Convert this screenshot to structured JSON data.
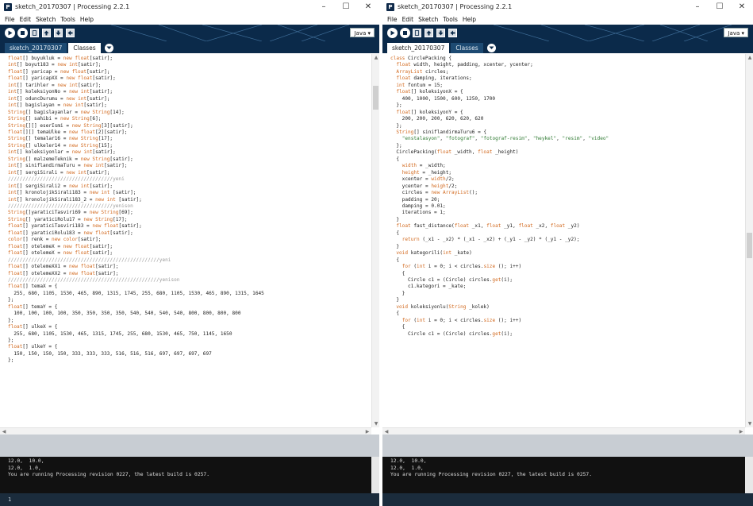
{
  "left": {
    "title": "sketch_20170307 | Processing 2.2.1",
    "menu": [
      "File",
      "Edit",
      "Sketch",
      "Tools",
      "Help"
    ],
    "mode": "Java ▾",
    "tabs": [
      "sketch_20170307",
      "Classes"
    ],
    "code": [
      [
        [
          "kw",
          "float"
        ],
        [
          "t",
          "[] buyukluk = "
        ],
        [
          "kw",
          "new float"
        ],
        [
          "t",
          "[satir];"
        ]
      ],
      [
        [
          "kw",
          "int"
        ],
        [
          "t",
          "[] boyut183 = "
        ],
        [
          "kw",
          "new int"
        ],
        [
          "t",
          "[satir];"
        ]
      ],
      [
        [
          "kw",
          "float"
        ],
        [
          "t",
          "[] yaricap = "
        ],
        [
          "kw",
          "new float"
        ],
        [
          "t",
          "[satir];"
        ]
      ],
      [
        [
          "kw",
          "float"
        ],
        [
          "t",
          "[] yaricapXX = "
        ],
        [
          "kw",
          "new float"
        ],
        [
          "t",
          "[satir];"
        ]
      ],
      [
        [
          "kw",
          "int"
        ],
        [
          "t",
          "[] tarihler = "
        ],
        [
          "kw",
          "new int"
        ],
        [
          "t",
          "[satir];"
        ]
      ],
      [
        [
          "kw",
          "int"
        ],
        [
          "t",
          "[] koleksiyonNo = "
        ],
        [
          "kw",
          "new int"
        ],
        [
          "t",
          "[satir];"
        ]
      ],
      [
        [
          "kw",
          "int"
        ],
        [
          "t",
          "[] oduncDurumu = "
        ],
        [
          "kw",
          "new int"
        ],
        [
          "t",
          "[satir];"
        ]
      ],
      [
        [
          "kw",
          "int"
        ],
        [
          "t",
          "[] bagislayan = "
        ],
        [
          "kw",
          "new int"
        ],
        [
          "t",
          "[satir];"
        ]
      ],
      [
        [
          "kw",
          "String"
        ],
        [
          "t",
          "[] bagislayanlar = "
        ],
        [
          "kw",
          "new String"
        ],
        [
          "t",
          "[14];"
        ]
      ],
      [
        [
          "kw",
          "String"
        ],
        [
          "t",
          "[] sahibi = "
        ],
        [
          "kw",
          "new String"
        ],
        [
          "t",
          "[6];"
        ]
      ],
      [
        [
          "kw",
          "String"
        ],
        [
          "t",
          "[][] eserIsmi = "
        ],
        [
          "kw",
          "new String"
        ],
        [
          "t",
          "[3][satir];"
        ]
      ],
      [
        [
          "kw",
          "float"
        ],
        [
          "t",
          "[][] temaUlke = "
        ],
        [
          "kw",
          "new float"
        ],
        [
          "t",
          "[2][satir];"
        ]
      ],
      [
        [
          "kw",
          "String"
        ],
        [
          "t",
          "[] temalar16 = "
        ],
        [
          "kw",
          "new String"
        ],
        [
          "t",
          "[17];"
        ]
      ],
      [
        [
          "kw",
          "String"
        ],
        [
          "t",
          "[] ulkeler14 = "
        ],
        [
          "kw",
          "new String"
        ],
        [
          "t",
          "[15];"
        ]
      ],
      [
        [
          "kw",
          "int"
        ],
        [
          "t",
          "[] koleksiyonlar = "
        ],
        [
          "kw",
          "new int"
        ],
        [
          "t",
          "[satir];"
        ]
      ],
      [
        [
          "kw",
          "String"
        ],
        [
          "t",
          "[] malzemeTeknik = "
        ],
        [
          "kw",
          "new String"
        ],
        [
          "t",
          "[satir];"
        ]
      ],
      [
        [
          "kw",
          "int"
        ],
        [
          "t",
          "[] siniflandirmaTuru = "
        ],
        [
          "kw",
          "new int"
        ],
        [
          "t",
          "[satir];"
        ]
      ],
      [
        [
          "kw",
          "int"
        ],
        [
          "t",
          "[] sergiSirali = "
        ],
        [
          "kw",
          "new int"
        ],
        [
          "t",
          "[satir];"
        ]
      ],
      [
        [
          "t",
          ""
        ]
      ],
      [
        [
          "cmt",
          "////////////////////////////////////yeni"
        ]
      ],
      [
        [
          "kw",
          "int"
        ],
        [
          "t",
          "[] sergiSirali2 = "
        ],
        [
          "kw",
          "new int"
        ],
        [
          "t",
          "[satir];"
        ]
      ],
      [
        [
          "kw",
          "int"
        ],
        [
          "t",
          "[] kronolojikSirali183 = "
        ],
        [
          "kw",
          "new int"
        ],
        [
          "t",
          " [satir];"
        ]
      ],
      [
        [
          "kw",
          "int"
        ],
        [
          "t",
          "[] kronolojikSirali183_2 = "
        ],
        [
          "kw",
          "new int"
        ],
        [
          "t",
          " [satir];"
        ]
      ],
      [
        [
          "cmt",
          "////////////////////////////////////yenison"
        ]
      ],
      [
        [
          "t",
          ""
        ]
      ],
      [
        [
          "kw",
          "String"
        ],
        [
          "t",
          "[]yaraticiTasviri69 = "
        ],
        [
          "kw",
          "new String"
        ],
        [
          "t",
          "[69];"
        ]
      ],
      [
        [
          "kw",
          "String"
        ],
        [
          "t",
          "[] yaraticiRolu17 = "
        ],
        [
          "kw",
          "new String"
        ],
        [
          "t",
          "[17];"
        ]
      ],
      [
        [
          "kw",
          "float"
        ],
        [
          "t",
          "[] yaraticiTasviri183 = "
        ],
        [
          "kw",
          "new float"
        ],
        [
          "t",
          "[satir];"
        ]
      ],
      [
        [
          "kw",
          "float"
        ],
        [
          "t",
          "[] yaraticiRolu183 = "
        ],
        [
          "kw",
          "new float"
        ],
        [
          "t",
          "[satir];"
        ]
      ],
      [
        [
          "kw",
          "color"
        ],
        [
          "t",
          "[] renk = "
        ],
        [
          "kw",
          "new color"
        ],
        [
          "t",
          "[satir];"
        ]
      ],
      [
        [
          "kw",
          "float"
        ],
        [
          "t",
          "[] otelemeX = "
        ],
        [
          "kw",
          "new float"
        ],
        [
          "t",
          "[satir];"
        ]
      ],
      [
        [
          "kw",
          "float"
        ],
        [
          "t",
          "[] otelemeX = "
        ],
        [
          "kw",
          "new float"
        ],
        [
          "t",
          "[satir];"
        ]
      ],
      [
        [
          "cmt",
          "////////////////////////////////////////////////////yeni"
        ]
      ],
      [
        [
          "kw",
          "float"
        ],
        [
          "t",
          "[] otelemeXX1 = "
        ],
        [
          "kw",
          "new float"
        ],
        [
          "t",
          "[satir];"
        ]
      ],
      [
        [
          "kw",
          "float"
        ],
        [
          "t",
          "[] otelemeXX2 = "
        ],
        [
          "kw",
          "new float"
        ],
        [
          "t",
          "[satir];"
        ]
      ],
      [
        [
          "cmt",
          "////////////////////////////////////////////////////yenison"
        ]
      ],
      [
        [
          "kw",
          "float"
        ],
        [
          "t",
          "[] temaX = {"
        ]
      ],
      [
        [
          "t",
          "  255, 680, 1105, 1530, 465, 890, 1315, 1745, 255, 680, 1105, 1530, 465, 890, 1315, 1645"
        ]
      ],
      [
        [
          "t",
          "};"
        ]
      ],
      [
        [
          "kw",
          "float"
        ],
        [
          "t",
          "[] temaY = {"
        ]
      ],
      [
        [
          "t",
          "  100, 100, 100, 100, 350, 350, 350, 350, 540, 540, 540, 540, 800, 800, 800, 800"
        ]
      ],
      [
        [
          "t",
          "};"
        ]
      ],
      [
        [
          "kw",
          "float"
        ],
        [
          "t",
          "[] ulkeX = {"
        ]
      ],
      [
        [
          "t",
          "  255, 680, 1105, 1530, 465, 1315, 1745, 255, 680, 1530, 465, 750, 1145, 1650"
        ]
      ],
      [
        [
          "t",
          "};"
        ]
      ],
      [
        [
          "kw",
          "float"
        ],
        [
          "t",
          "[] ulkeY = {"
        ]
      ],
      [
        [
          "t",
          "  150, 150, 150, 150, 333, 333, 333, 516, 516, 516, 697, 697, 697, 697"
        ]
      ],
      [
        [
          "t",
          "};"
        ]
      ]
    ],
    "console": [
      "12.0,  10.0,",
      "12.0,  1.0,",
      "You are running Processing revision 0227, the latest build is 0257."
    ],
    "status": "1"
  },
  "right": {
    "title": "sketch_20170307 | Processing 2.2.1",
    "menu": [
      "File",
      "Edit",
      "Sketch",
      "Tools",
      "Help"
    ],
    "mode": "Java ▾",
    "tabs": [
      "sketch_20170307",
      "Classes"
    ],
    "code": [
      [
        [
          "kw",
          "class"
        ],
        [
          "t",
          " CirclePacking {"
        ]
      ],
      [
        [
          "t",
          ""
        ]
      ],
      [
        [
          "t",
          "  "
        ],
        [
          "kw",
          "float"
        ],
        [
          "t",
          " width, height, padding, xcenter, ycenter;"
        ]
      ],
      [
        [
          "t",
          "  "
        ],
        [
          "kw",
          "ArrayList"
        ],
        [
          "t",
          " circles;"
        ]
      ],
      [
        [
          "t",
          "  "
        ],
        [
          "kw",
          "float"
        ],
        [
          "t",
          " damping, iterations;"
        ]
      ],
      [
        [
          "t",
          "  "
        ],
        [
          "kw",
          "int"
        ],
        [
          "t",
          " fontum = 15;"
        ]
      ],
      [
        [
          "t",
          "  "
        ],
        [
          "kw",
          "float"
        ],
        [
          "t",
          "[] koleksiyonX = {"
        ]
      ],
      [
        [
          "t",
          "    400, 1000, 1500, 600, 1250, 1700"
        ]
      ],
      [
        [
          "t",
          "  };"
        ]
      ],
      [
        [
          "t",
          "  "
        ],
        [
          "kw",
          "float"
        ],
        [
          "t",
          "[] koleksiyonY = {"
        ]
      ],
      [
        [
          "t",
          "    200, 200, 200, 620, 620, 620"
        ]
      ],
      [
        [
          "t",
          "  };"
        ]
      ],
      [
        [
          "t",
          "  "
        ],
        [
          "kw",
          "String"
        ],
        [
          "t",
          "[] siniflandirmaTuru6 = {"
        ]
      ],
      [
        [
          "t",
          "    "
        ],
        [
          "str",
          "\"enstalasyon\""
        ],
        [
          "t",
          ", "
        ],
        [
          "str",
          "\"fotograf\""
        ],
        [
          "t",
          ", "
        ],
        [
          "str",
          "\"fotograf-resim\""
        ],
        [
          "t",
          ", "
        ],
        [
          "str",
          "\"heykel\""
        ],
        [
          "t",
          ", "
        ],
        [
          "str",
          "\"resim\""
        ],
        [
          "t",
          ", "
        ],
        [
          "str",
          "\"video\""
        ]
      ],
      [
        [
          "t",
          "  };"
        ]
      ],
      [
        [
          "t",
          ""
        ]
      ],
      [
        [
          "t",
          ""
        ]
      ],
      [
        [
          "t",
          ""
        ]
      ],
      [
        [
          "t",
          "  CirclePacking("
        ],
        [
          "kw",
          "float"
        ],
        [
          "t",
          " _width, "
        ],
        [
          "kw",
          "float"
        ],
        [
          "t",
          " _height)"
        ]
      ],
      [
        [
          "t",
          "  {"
        ]
      ],
      [
        [
          "t",
          "    "
        ],
        [
          "kw",
          "width"
        ],
        [
          "t",
          " = _width;"
        ]
      ],
      [
        [
          "t",
          "    "
        ],
        [
          "kw",
          "height"
        ],
        [
          "t",
          " = _height;"
        ]
      ],
      [
        [
          "t",
          "    xcenter = "
        ],
        [
          "kw",
          "width"
        ],
        [
          "t",
          "/2;"
        ]
      ],
      [
        [
          "t",
          "    ycenter = "
        ],
        [
          "kw",
          "height"
        ],
        [
          "t",
          "/2;"
        ]
      ],
      [
        [
          "t",
          "    circles = "
        ],
        [
          "kw",
          "new ArrayList"
        ],
        [
          "t",
          "();"
        ]
      ],
      [
        [
          "t",
          "    padding = 20;"
        ]
      ],
      [
        [
          "t",
          "    damping = 0.01;"
        ]
      ],
      [
        [
          "t",
          "    iterations = 1;"
        ]
      ],
      [
        [
          "t",
          "  }"
        ]
      ],
      [
        [
          "t",
          ""
        ]
      ],
      [
        [
          "t",
          "  "
        ],
        [
          "kw",
          "float"
        ],
        [
          "t",
          " fast_distance("
        ],
        [
          "kw",
          "float"
        ],
        [
          "t",
          " _x1, "
        ],
        [
          "kw",
          "float"
        ],
        [
          "t",
          " _y1, "
        ],
        [
          "kw",
          "float"
        ],
        [
          "t",
          " _x2, "
        ],
        [
          "kw",
          "float"
        ],
        [
          "t",
          " _y2)"
        ]
      ],
      [
        [
          "t",
          "  {"
        ]
      ],
      [
        [
          "t",
          "    "
        ],
        [
          "kw",
          "return"
        ],
        [
          "t",
          " (_x1 - _x2) * (_x1 - _x2) + (_y1 - _y2) * (_y1 - _y2);"
        ]
      ],
      [
        [
          "t",
          "  }"
        ]
      ],
      [
        [
          "t",
          ""
        ]
      ],
      [
        [
          "t",
          "  "
        ],
        [
          "kw",
          "void"
        ],
        [
          "t",
          " kategorili("
        ],
        [
          "kw",
          "int"
        ],
        [
          "t",
          " _kate)"
        ]
      ],
      [
        [
          "t",
          "  {"
        ]
      ],
      [
        [
          "t",
          "    "
        ],
        [
          "kw",
          "for"
        ],
        [
          "t",
          " ("
        ],
        [
          "kw",
          "int"
        ],
        [
          "t",
          " i = 0; i < circles."
        ],
        [
          "kw",
          "size"
        ],
        [
          "t",
          " (); i++)"
        ]
      ],
      [
        [
          "t",
          "    {"
        ]
      ],
      [
        [
          "t",
          "      Circle c1 = (Circle) circles."
        ],
        [
          "kw",
          "get"
        ],
        [
          "t",
          "(i);"
        ]
      ],
      [
        [
          "t",
          "      c1.kategori = _kate;"
        ]
      ],
      [
        [
          "t",
          "    }"
        ]
      ],
      [
        [
          "t",
          "  }"
        ]
      ],
      [
        [
          "t",
          ""
        ]
      ],
      [
        [
          "t",
          "  "
        ],
        [
          "kw",
          "void"
        ],
        [
          "t",
          " koleksiyonlu("
        ],
        [
          "kw",
          "String"
        ],
        [
          "t",
          " _kolek)"
        ]
      ],
      [
        [
          "t",
          "  {"
        ]
      ],
      [
        [
          "t",
          "    "
        ],
        [
          "kw",
          "for"
        ],
        [
          "t",
          " ("
        ],
        [
          "kw",
          "int"
        ],
        [
          "t",
          " i = 0; i < circles."
        ],
        [
          "kw",
          "size"
        ],
        [
          "t",
          " (); i++)"
        ]
      ],
      [
        [
          "t",
          "    {"
        ]
      ],
      [
        [
          "t",
          "      Circle c1 = (Circle) circles."
        ],
        [
          "kw",
          "get"
        ],
        [
          "t",
          "(i);"
        ]
      ]
    ],
    "console": [
      "12.0,  10.0,",
      "12.0,  1.0,",
      "You are running Processing revision 0227, the latest build is 0257."
    ],
    "status": ""
  }
}
